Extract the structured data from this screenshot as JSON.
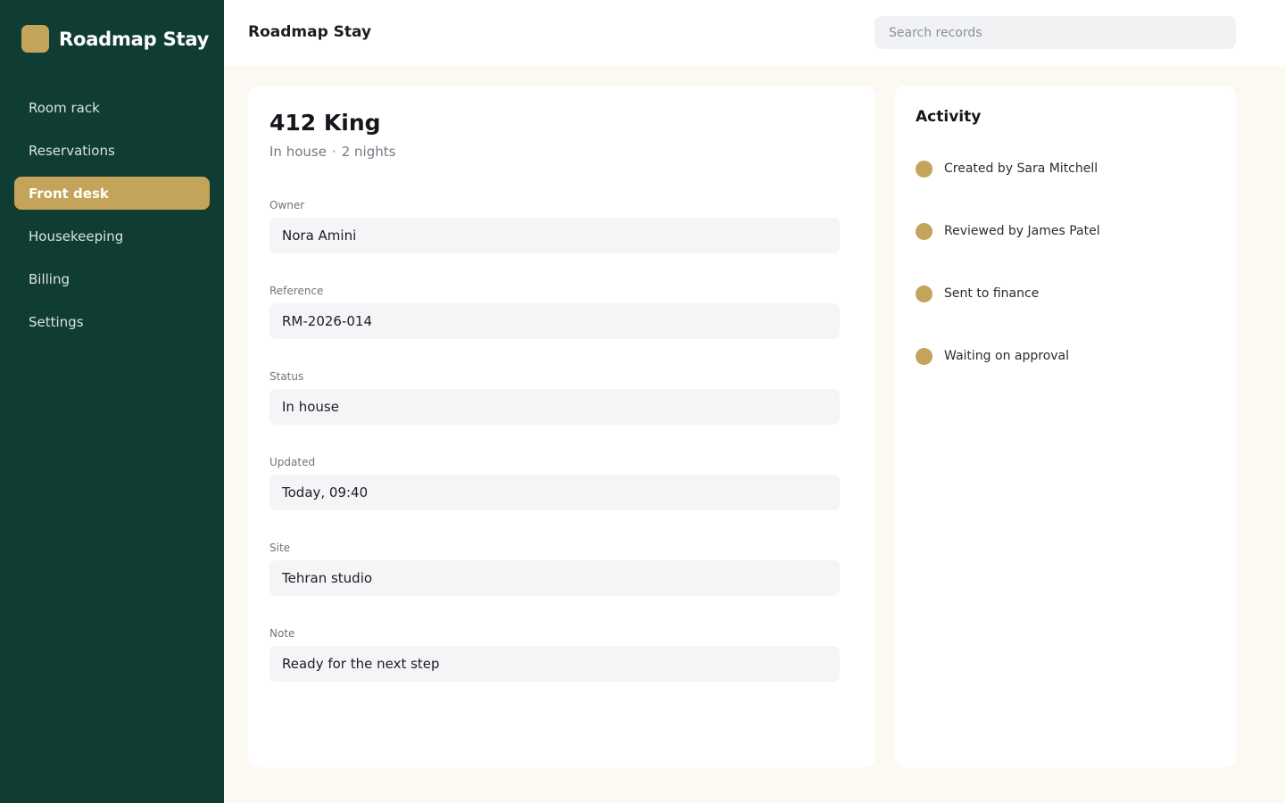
{
  "app": {
    "brand": "Roadmap Stay",
    "colors": {
      "sidebar": "#103d33",
      "accent": "#c4a35a",
      "background": "#fbf9f1"
    }
  },
  "sidebar": {
    "items": [
      {
        "label": "Room rack",
        "active": false
      },
      {
        "label": "Reservations",
        "active": false
      },
      {
        "label": "Front desk",
        "active": true
      },
      {
        "label": "Housekeeping",
        "active": false
      },
      {
        "label": "Billing",
        "active": false
      },
      {
        "label": "Settings",
        "active": false
      }
    ]
  },
  "header": {
    "title": "Roadmap Stay",
    "search_placeholder": "Search records",
    "search_value": ""
  },
  "record": {
    "title": "412 King",
    "status": "In house",
    "separator": "·",
    "nights": "2 nights",
    "fields": [
      {
        "label": "Owner",
        "value": "Nora Amini"
      },
      {
        "label": "Reference",
        "value": "RM-2026-014"
      },
      {
        "label": "Status",
        "value": "In house"
      },
      {
        "label": "Updated",
        "value": "Today, 09:40"
      },
      {
        "label": "Site",
        "value": "Tehran studio"
      },
      {
        "label": "Note",
        "value": "Ready for the next step"
      }
    ]
  },
  "activity": {
    "title": "Activity",
    "items": [
      "Created by Sara Mitchell",
      "Reviewed by James Patel",
      "Sent to finance",
      "Waiting on approval"
    ]
  }
}
